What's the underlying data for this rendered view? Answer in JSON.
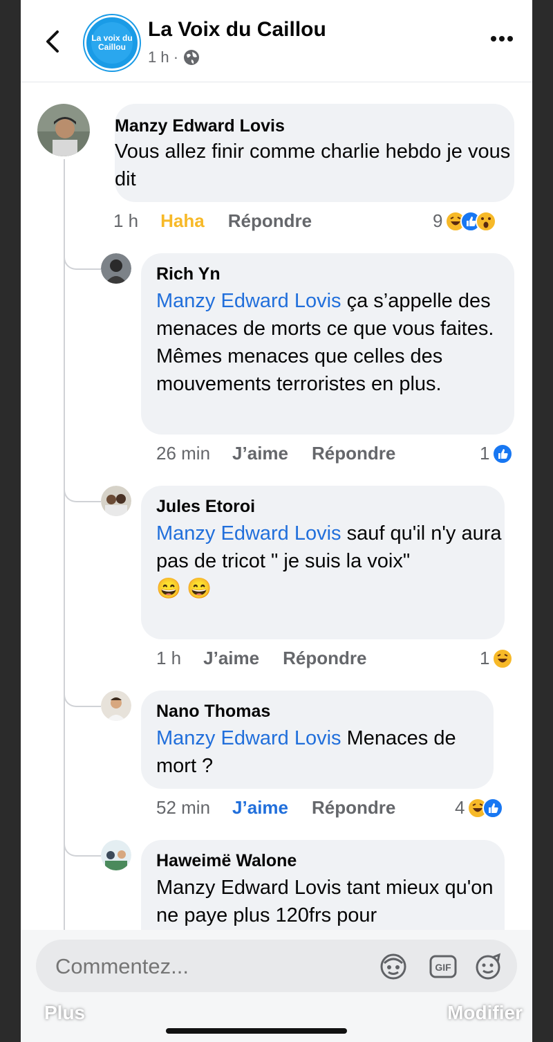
{
  "header": {
    "page_name": "La Voix du Caillou",
    "time": "1 h ·",
    "logo_text": "La voix du Caillou"
  },
  "comments": [
    {
      "author": "Manzy Edward Lovis",
      "text": "Vous allez finir comme charlie hebdo je vous dit",
      "time": "1 h",
      "action_like": "Haha",
      "action_reply": "Répondre",
      "reaction_count": "9"
    },
    {
      "author": "Rich Yn",
      "mention": "Manzy Edward Lovis",
      "text": " ça s’appelle des menaces de morts ce que vous faites. Mêmes menaces que celles des mouvements terroristes  en plus.",
      "time": "26 min",
      "action_like": "J’aime",
      "action_reply": "Répondre",
      "reaction_count": "1"
    },
    {
      "author": "Jules Etoroi",
      "mention": "Manzy Edward Lovis",
      "text": " sauf qu'il n'y aura pas de tricot \" je suis la voix\"",
      "emoji": "😄 😄",
      "time": "1 h",
      "action_like": "J’aime",
      "action_reply": "Répondre",
      "reaction_count": "1"
    },
    {
      "author": "Nano Thomas",
      "mention": "Manzy Edward Lovis",
      "text": "  Menaces de mort ?",
      "time": "52 min",
      "action_like": "J’aime",
      "action_reply": "Répondre",
      "reaction_count": "4"
    },
    {
      "author": "Haweimë Walone",
      "text": "Manzy Edward Lovis tant mieux qu'on ne paye plus 120frs pour"
    }
  ],
  "composer": {
    "placeholder": "Commentez..."
  },
  "bottom": {
    "left_label": "Plus",
    "right_label": "Modifier"
  },
  "colors": {
    "accent": "#216fdb",
    "haha": "#f7b928",
    "bubble": "#f0f2f5"
  }
}
